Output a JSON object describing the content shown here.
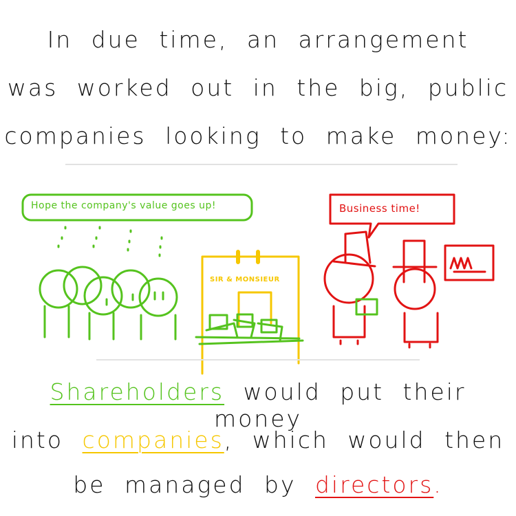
{
  "top_text": {
    "line1": "In due time, an arrangement",
    "line2": "was worked out in the big, public",
    "line3": "companies looking to make money:"
  },
  "illustration": {
    "shareholders_speech": "Hope the company's value goes up!",
    "building_sign": "SIR & MONSIEUR",
    "directors_speech": "Business time!"
  },
  "bottom_text": {
    "shareholders": "Shareholders",
    "line1_rest": "would put their money",
    "line2_start": "into",
    "companies": "companies",
    "line2_rest": ", which would then",
    "line3_start": "be managed by",
    "directors": "directors",
    "line3_end": "."
  },
  "colors": {
    "shareholders": "#55c31e",
    "companies": "#f6c700",
    "directors": "#e21313"
  }
}
